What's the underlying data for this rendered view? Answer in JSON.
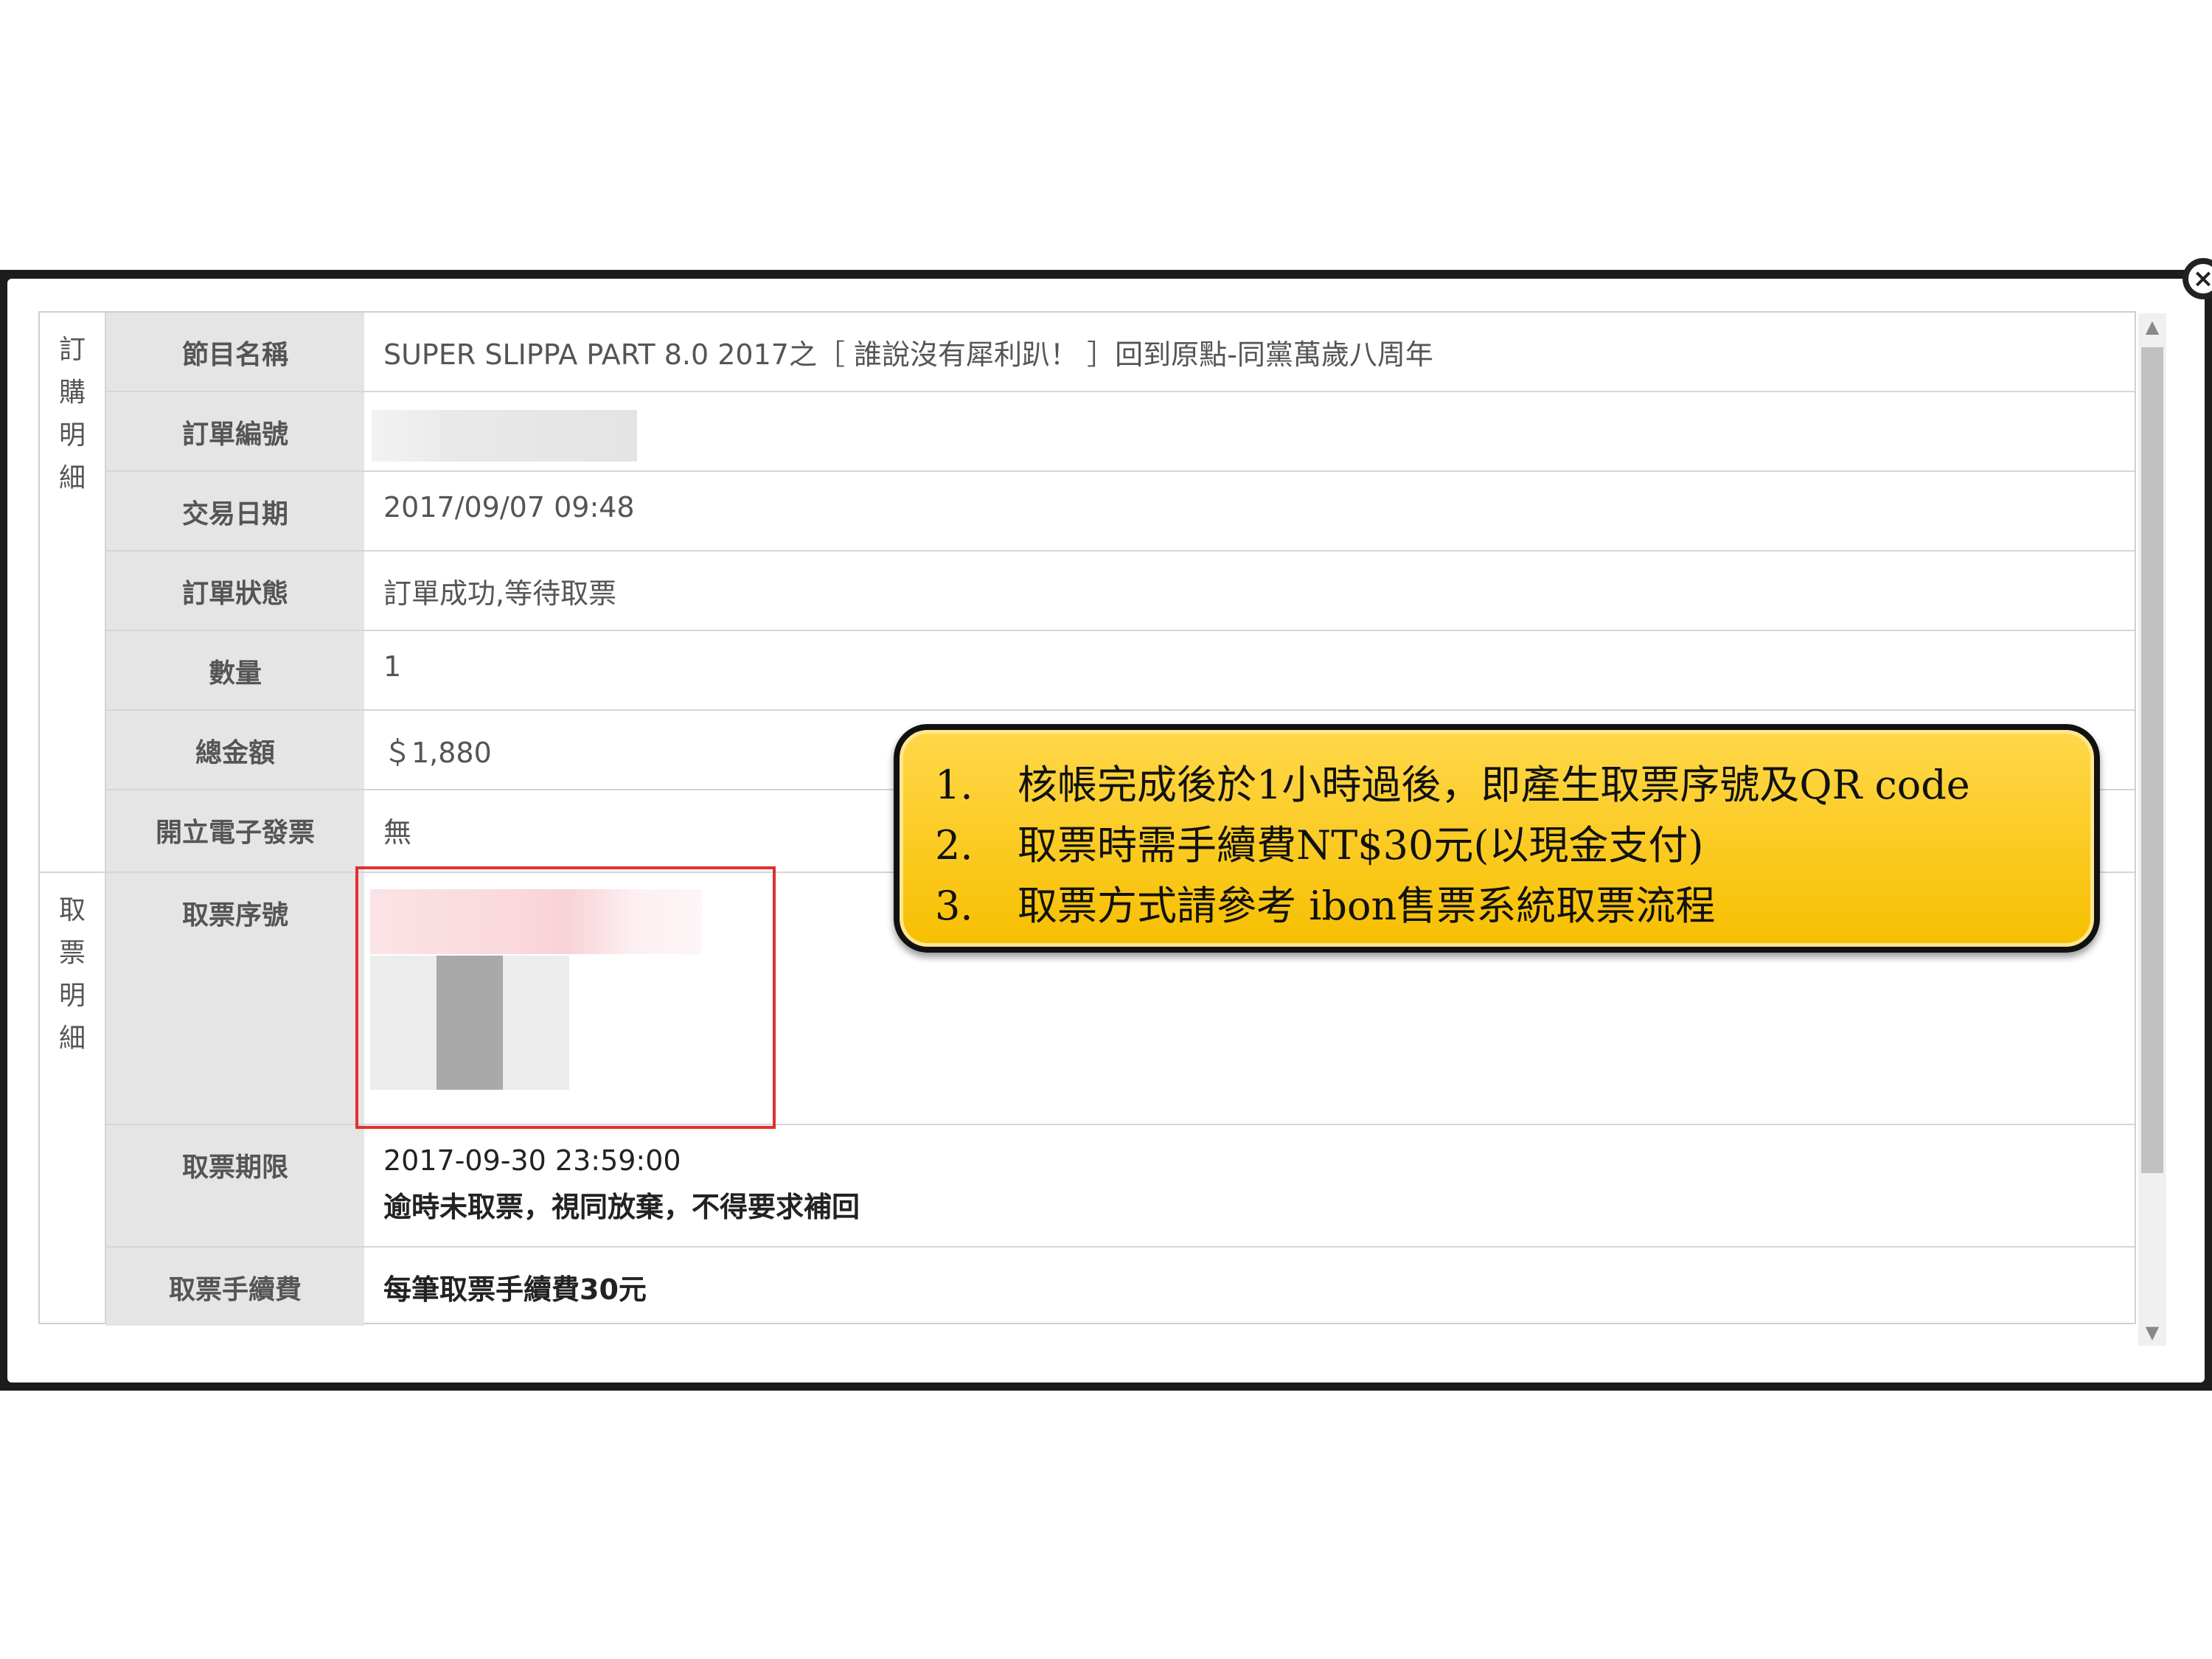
{
  "close_label": "×",
  "sections": {
    "order": "訂購明細",
    "pickup": "取票明細"
  },
  "rows": {
    "program_name": {
      "label": "節目名稱",
      "value": "SUPER SLIPPA PART 8.0 2017之［ 誰說沒有犀利趴！ ］回到原點-同黨萬歲八周年"
    },
    "order_number": {
      "label": "訂單編號",
      "value": ""
    },
    "trade_date": {
      "label": "交易日期",
      "value": "2017/09/07 09:48"
    },
    "order_status": {
      "label": "訂單狀態",
      "value": "訂單成功,等待取票"
    },
    "quantity": {
      "label": "數量",
      "value": "1"
    },
    "total": {
      "label": "總金額",
      "value": "＄1,880"
    },
    "einvoice": {
      "label": "開立電子發票",
      "value": "無"
    },
    "pickup_serial": {
      "label": "取票序號",
      "value": ""
    },
    "pickup_deadline": {
      "label": "取票期限",
      "value": "2017-09-30 23:59:00",
      "note": "逾時未取票，視同放棄，不得要求補回"
    },
    "pickup_fee": {
      "label": "取票手續費",
      "value": "每筆取票手續費30元"
    }
  },
  "callout": {
    "items": [
      {
        "num": "1.",
        "text": "核帳完成後於1小時過後，即產生取票序號及QR code"
      },
      {
        "num": "2.",
        "text": "取票時需手續費NT$30元(以現金支付)"
      },
      {
        "num": "3.",
        "text": "取票方式請參考 ibon售票系統取票流程"
      }
    ]
  },
  "scrollbar": {
    "up_icon": "▲",
    "down_icon": "▼"
  },
  "colors": {
    "highlight_border": "#e0312e",
    "callout_fill": "#fcc800"
  }
}
